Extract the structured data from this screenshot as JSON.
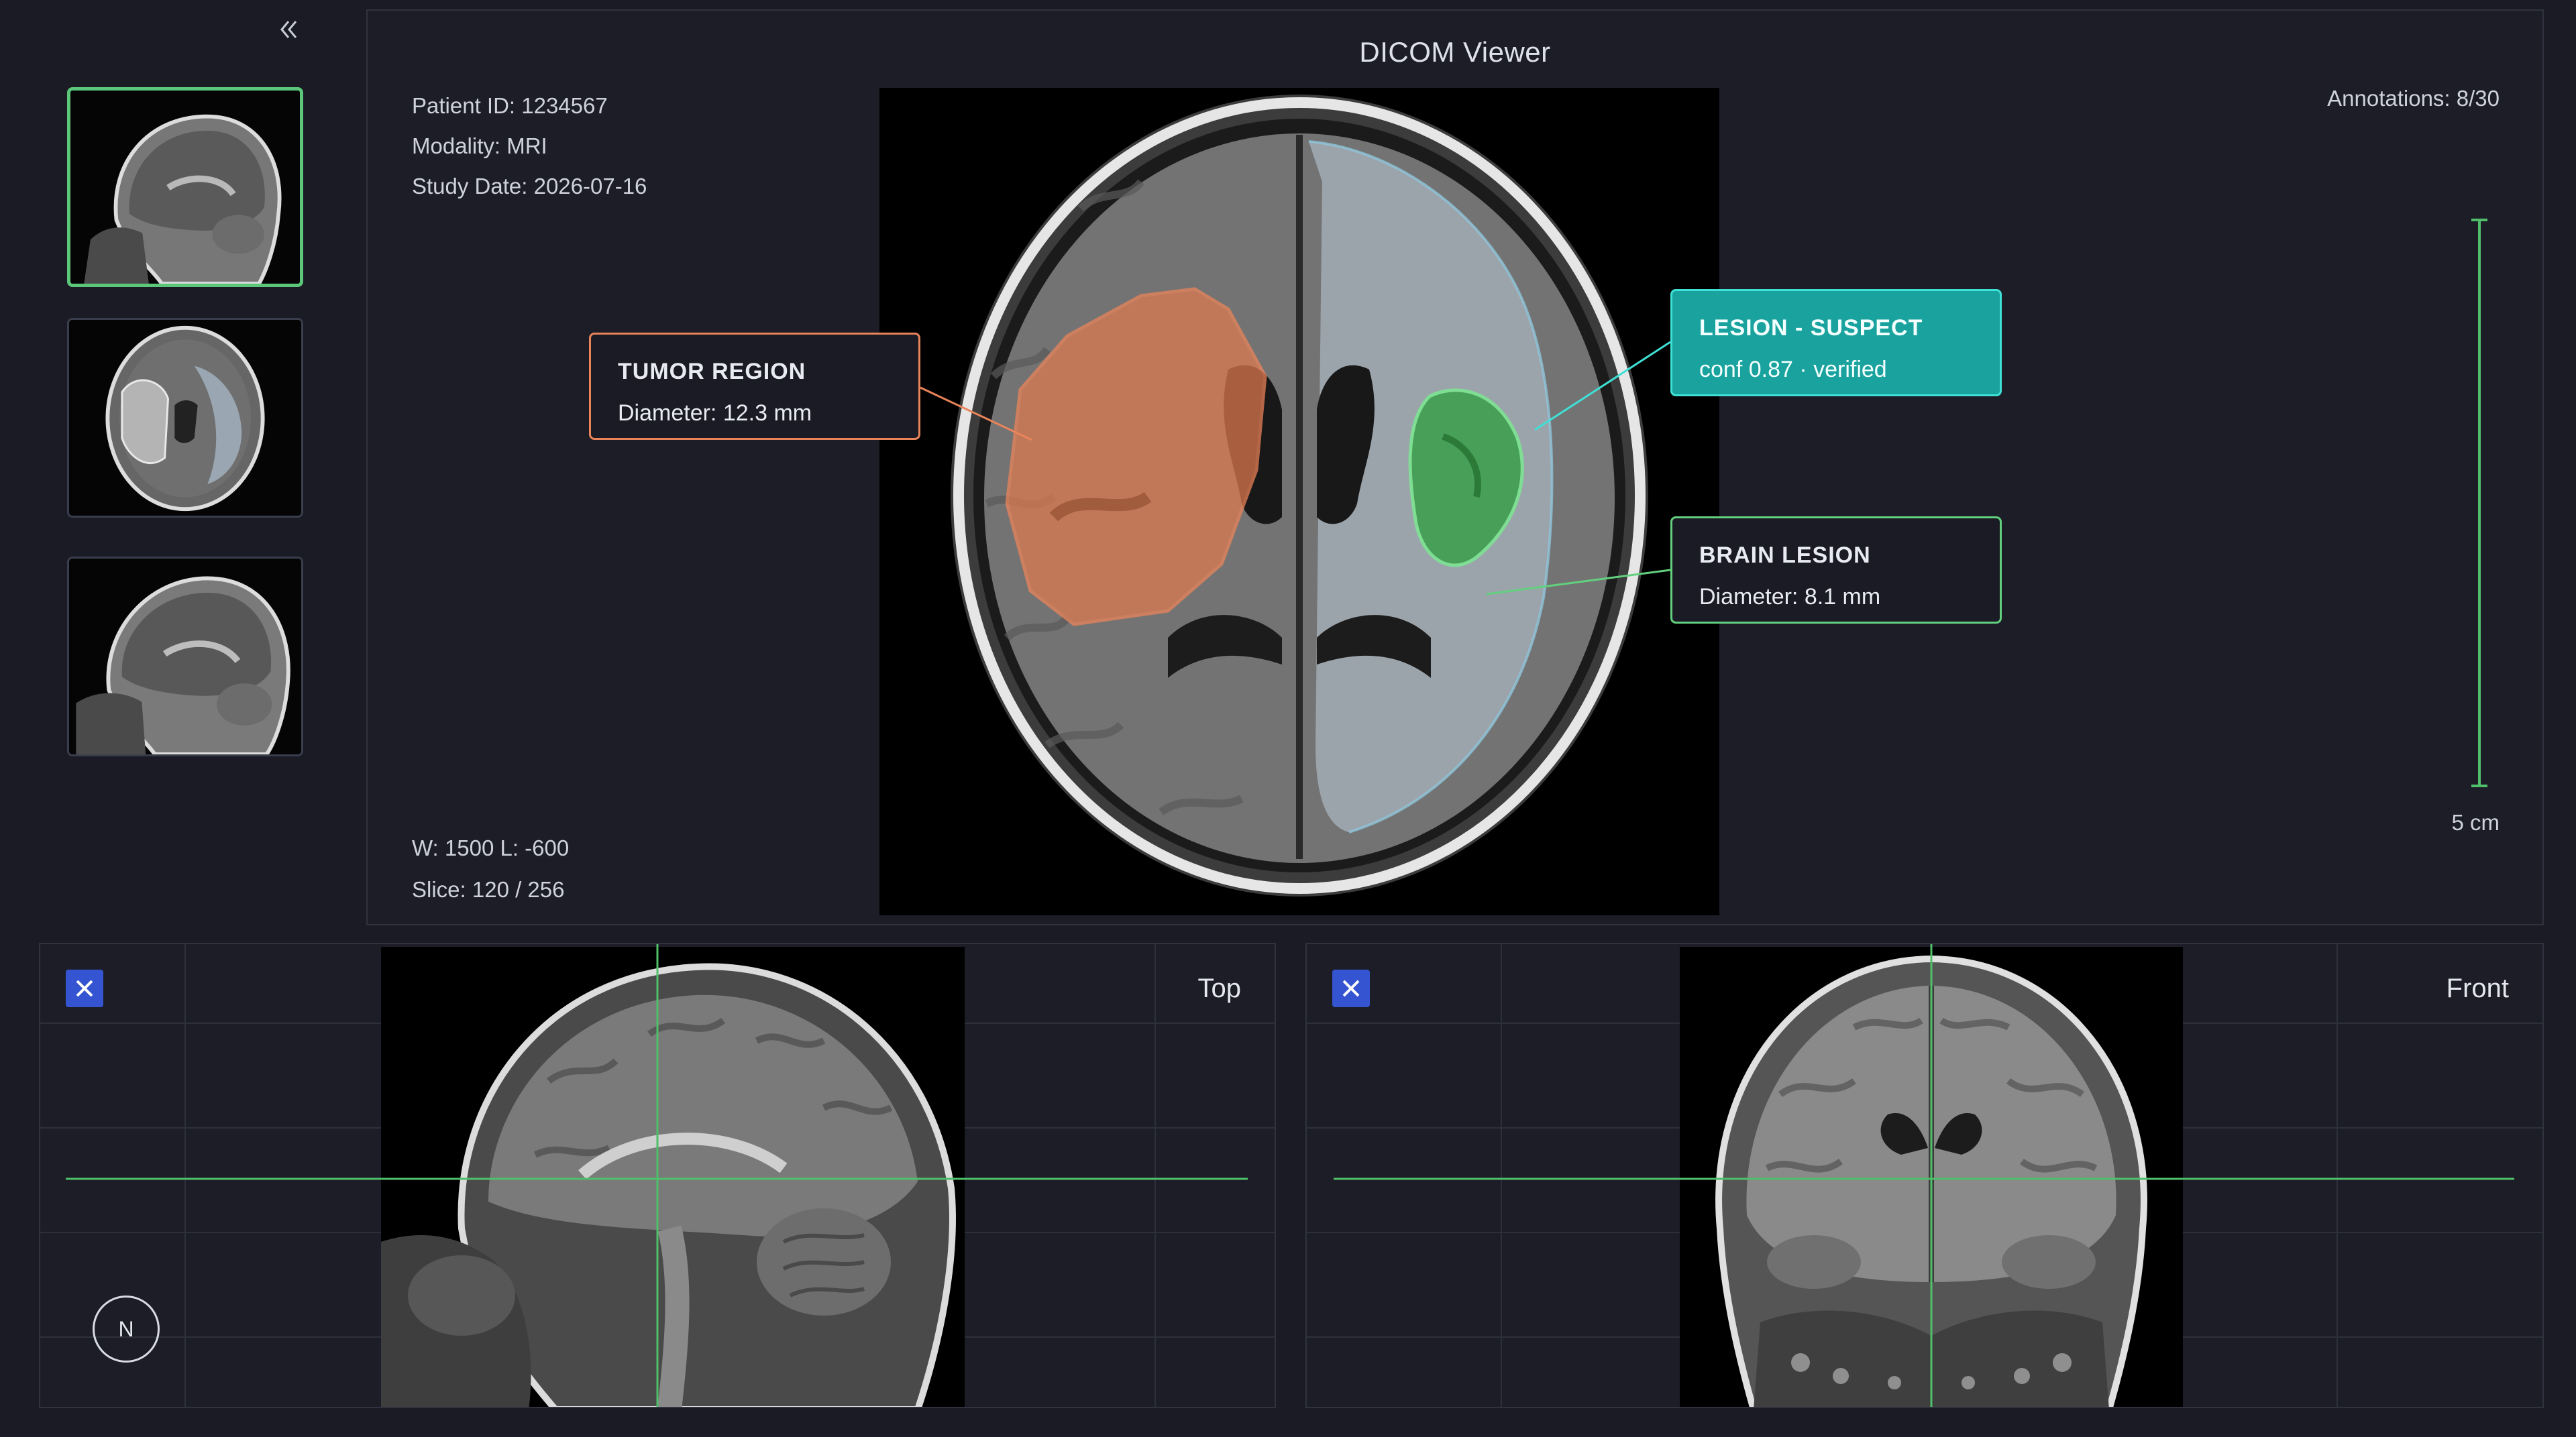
{
  "thumbnails": [
    {
      "icon": "brain-sagittal-thumbnail",
      "selected": true
    },
    {
      "icon": "brain-axial-thumbnail",
      "selected": false
    },
    {
      "icon": "brain-sagittal-thumbnail",
      "selected": false
    }
  ],
  "viewer": {
    "title": "DICOM Viewer",
    "patient_id": "Patient ID: 1234567",
    "modality": "Modality: MRI",
    "study_date": "Study Date: 2026-07-16",
    "annotations": "Annotations: 8/30",
    "window_level": "W: 1500 L: -600",
    "slice": "Slice: 120 / 256",
    "scale": "5 cm"
  },
  "callouts": {
    "tumor": {
      "title": "TUMOR REGION",
      "detail": "Diameter: 12.3 mm",
      "color": "#e9845a"
    },
    "lesion_suspect": {
      "title": "LESION - SUSPECT",
      "detail": "conf 0.87 · verified",
      "color": "#1aa39e"
    },
    "brain_lesion": {
      "title": "BRAIN LESION",
      "detail": "Diameter: 8.1 mm",
      "color": "#62d07e"
    }
  },
  "panels": {
    "left": {
      "label": "Top",
      "compass": "N"
    },
    "right": {
      "label": "Front"
    }
  },
  "colors": {
    "background": "#1a1b24",
    "accent_green": "#5cc77a",
    "accent_blue": "#3554d1",
    "tumor_orange": "#e9845a",
    "lesion_teal": "#1aa39e"
  }
}
